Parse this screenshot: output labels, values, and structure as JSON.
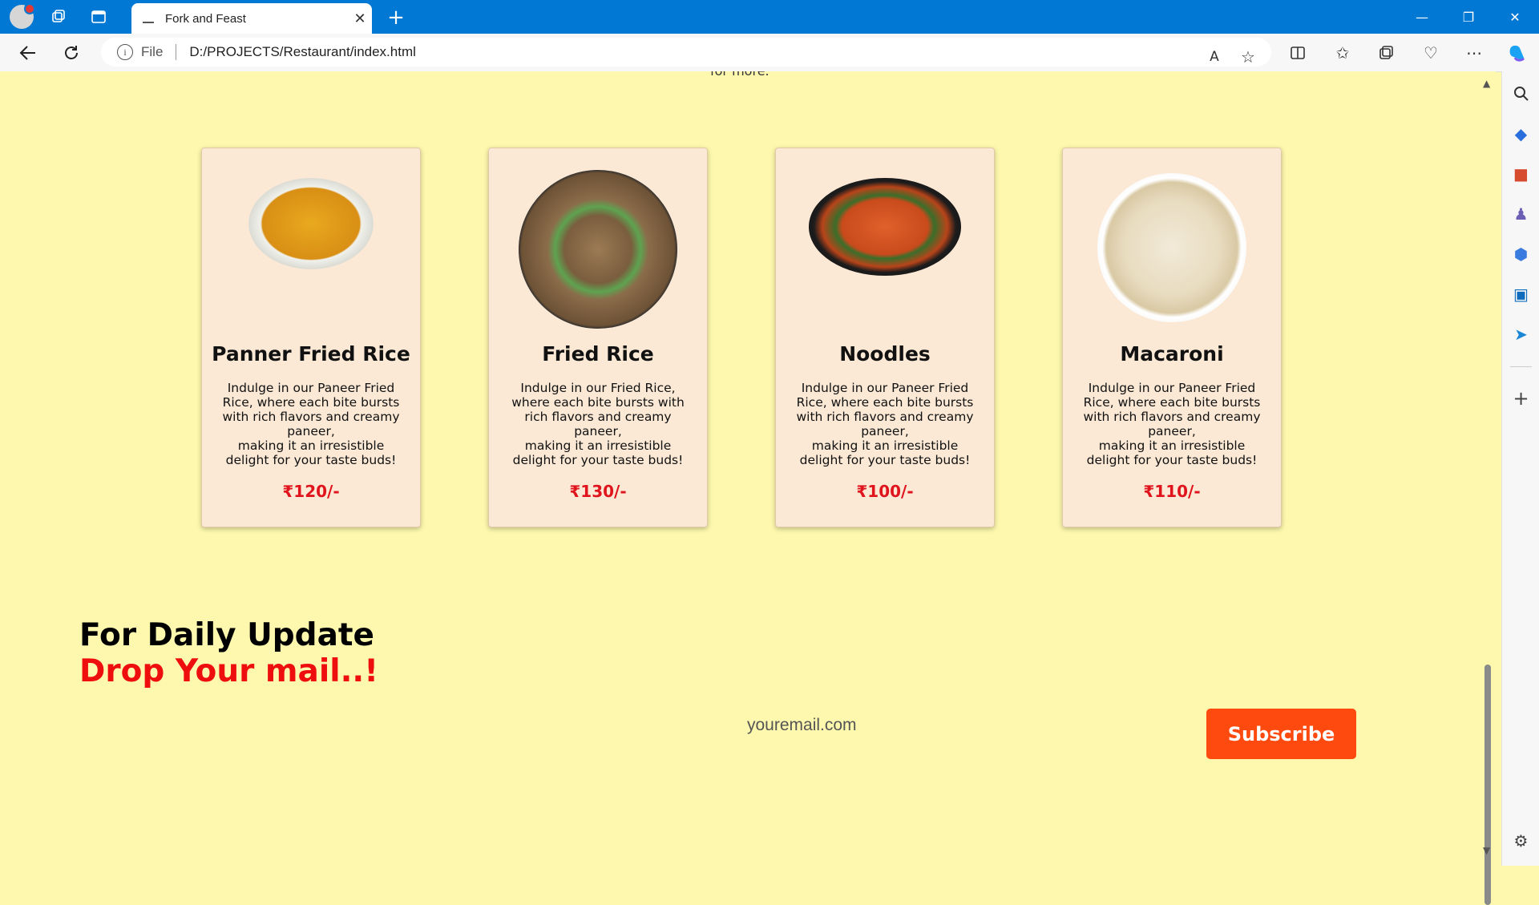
{
  "browser": {
    "tab_title": "Fork and Feast",
    "address_prefix": "File",
    "url": "D:/PROJECTS/Restaurant/index.html"
  },
  "page": {
    "top_cut_text": "for more.",
    "cards": [
      {
        "name": "Panner Fried Rice",
        "description": "Indulge in our Paneer Fried Rice, where each bite bursts with rich flavors and creamy paneer,\nmaking it an irresistible delight for your taste buds!",
        "price": "₹120/-"
      },
      {
        "name": "Fried Rice",
        "description": "Indulge in our Fried Rice, where each bite bursts with rich flavors and creamy paneer,\nmaking it an irresistible delight for your taste buds!",
        "price": "₹130/-"
      },
      {
        "name": "Noodles",
        "description": "Indulge in our Paneer Fried Rice, where each bite bursts with rich flavors and creamy paneer,\nmaking it an irresistible delight for your taste buds!",
        "price": "₹100/-"
      },
      {
        "name": "Macaroni",
        "description": "Indulge in our Paneer Fried Rice, where each bite bursts with rich flavors and creamy paneer,\nmaking it an irresistible delight for your taste buds!",
        "price": "₹110/-"
      }
    ],
    "newsletter": {
      "title": "For Daily Update",
      "subtitle": "Drop Your mail..!",
      "email_placeholder": "youremail.com",
      "button_label": "Subscribe"
    }
  },
  "colors": {
    "page_background": "#fdf8ad",
    "card_background": "#fbe9d6",
    "price": "#e0141d",
    "accent_red": "#ee0e0e",
    "button": "#ff4a0f",
    "titlebar": "#0078d4"
  }
}
